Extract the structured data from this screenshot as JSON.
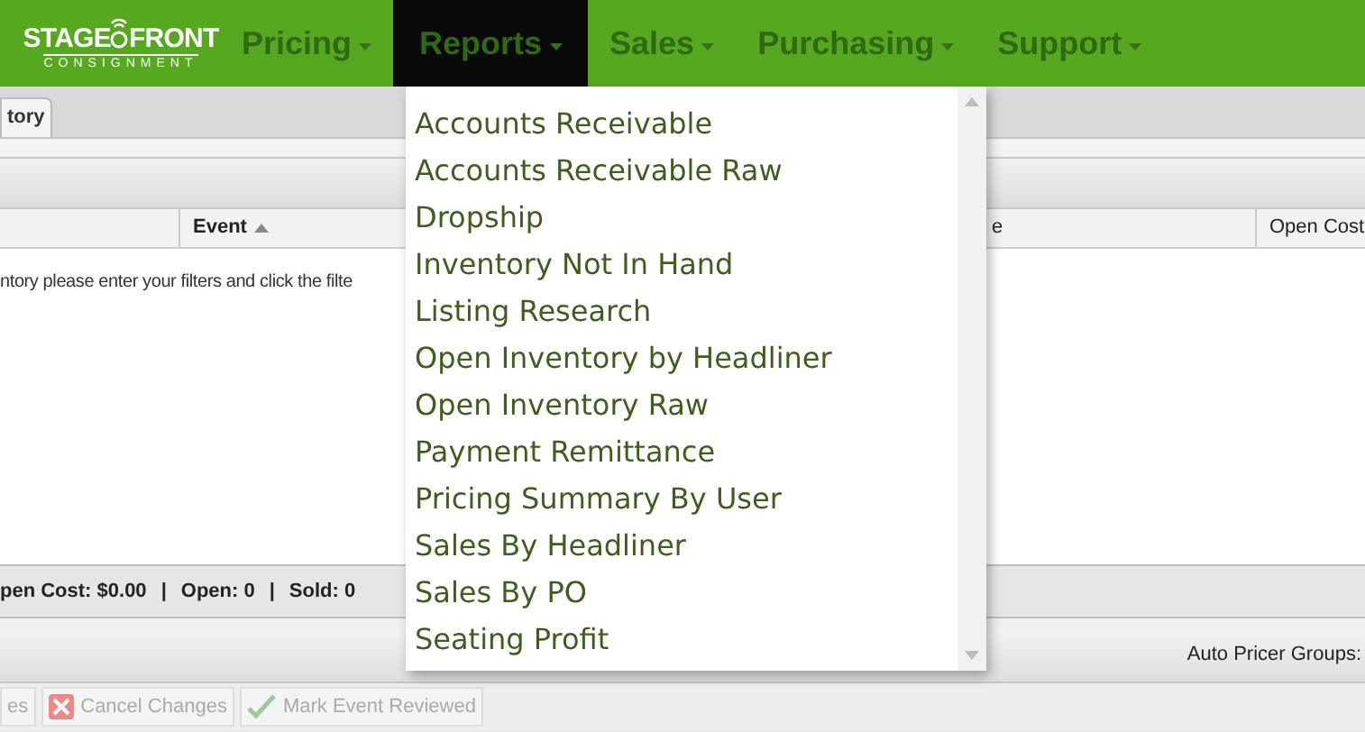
{
  "logo": {
    "line_1_left": "STAGE",
    "line_1_right": "FRONT",
    "line_2": "CONSIGNMENT"
  },
  "nav": [
    {
      "label": "Pricing",
      "selected": false
    },
    {
      "label": "Reports",
      "selected": true
    },
    {
      "label": "Sales",
      "selected": false
    },
    {
      "label": "Purchasing",
      "selected": false
    },
    {
      "label": "Support",
      "selected": false
    }
  ],
  "tabs": [
    {
      "label": "tory",
      "selected": true
    }
  ],
  "table": {
    "columns": [
      {
        "label": "Event",
        "sorted": true
      },
      {
        "label": "e",
        "sorted": false
      },
      {
        "label": "Open Cost",
        "sorted": false
      }
    ],
    "message": "ntory please enter your filters and click the filte"
  },
  "summary": {
    "separator": "|",
    "items": [
      "pen Cost: $0.00",
      "Open: 0",
      "Sold: 0"
    ]
  },
  "toolbar": {
    "label": "Auto Pricer Groups:"
  },
  "actions": [
    {
      "label": "es",
      "kind": "plain"
    },
    {
      "label": "Cancel Changes",
      "kind": "cancel"
    },
    {
      "label": "Mark Event Reviewed",
      "kind": "check"
    }
  ],
  "reports_menu": [
    "Accounts Receivable",
    "Accounts Receivable Raw",
    "Dropship",
    "Inventory Not In Hand",
    "Listing Research",
    "Open Inventory by Headliner",
    "Open Inventory Raw",
    "Payment Remittance",
    "Pricing Summary By User",
    "Sales By Headliner",
    "Sales By PO",
    "Seating Profit"
  ]
}
